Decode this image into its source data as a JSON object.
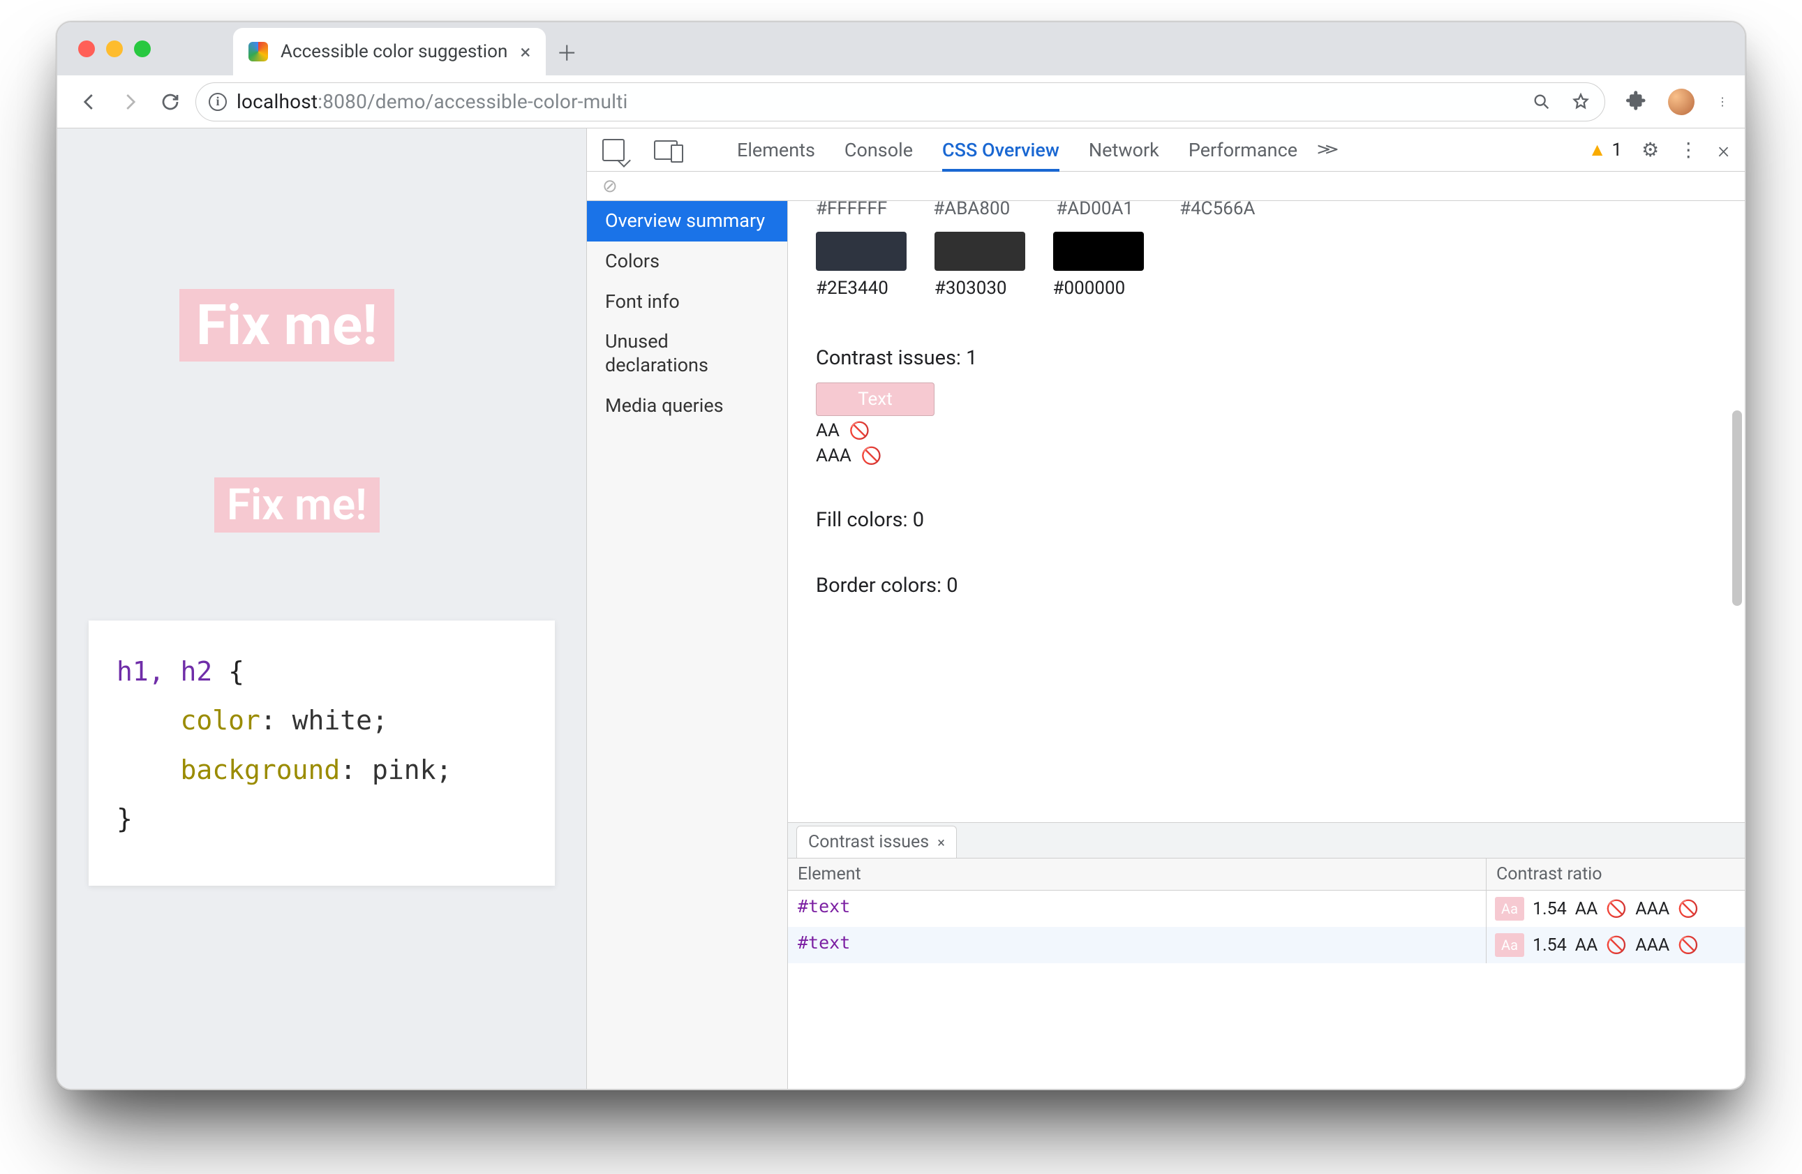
{
  "browser": {
    "tab_title": "Accessible color suggestion",
    "url_host": "localhost",
    "url_port": ":8080",
    "url_path": "/demo/accessible-color-multi"
  },
  "page": {
    "heading1": "Fix me!",
    "heading2": "Fix me!",
    "code": {
      "selector": "h1, h2",
      "open": " {",
      "prop1": "color",
      "val1": ": white;",
      "prop2": "background",
      "val2": ": pink;",
      "close": "}"
    }
  },
  "devtools": {
    "tabs": {
      "elements": "Elements",
      "console": "Console",
      "css_overview": "CSS Overview",
      "network": "Network",
      "performance": "Performance"
    },
    "warning_count": "1",
    "sidebar": {
      "overview": "Overview summary",
      "colors": "Colors",
      "font": "Font info",
      "unused": "Unused declarations",
      "media": "Media queries"
    },
    "top_hex": {
      "c1": "#FFFFFF",
      "c2": "#ABA800",
      "c3": "#AD00A1",
      "c4": "#4C566A"
    },
    "swatches2": {
      "c1": "#2E3440",
      "c2": "#303030",
      "c3": "#000000"
    },
    "contrast_label": "Contrast issues: 1",
    "contrast_chip": "Text",
    "aa_label": "AA",
    "aaa_label": "AAA",
    "fill_label": "Fill colors: 0",
    "border_label": "Border colors: 0",
    "drawer": {
      "tab": "Contrast issues",
      "col_element": "Element",
      "col_ratio": "Contrast ratio",
      "rows": [
        {
          "el": "#text",
          "ratio": "1.54",
          "aa": "AA",
          "aaa": "AAA"
        },
        {
          "el": "#text",
          "ratio": "1.54",
          "aa": "AA",
          "aaa": "AAA"
        }
      ],
      "swatch_label": "Aa"
    }
  }
}
